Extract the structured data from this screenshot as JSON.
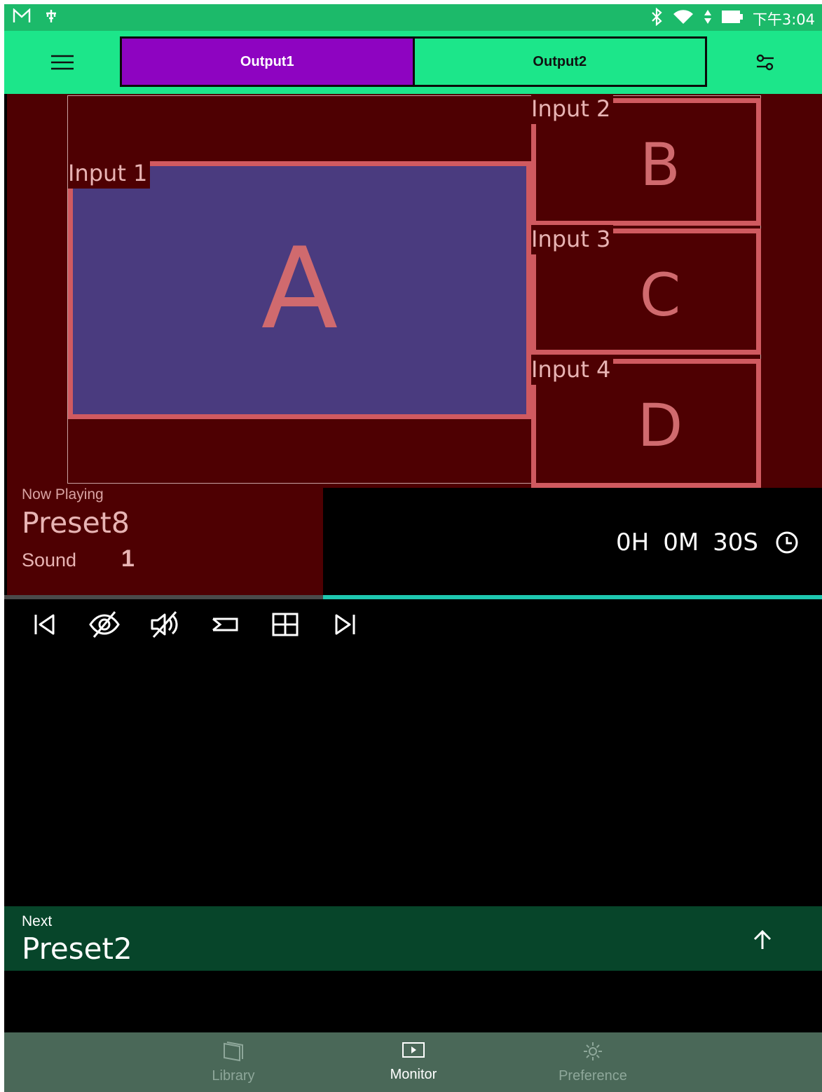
{
  "status_bar": {
    "time": "下午3:04",
    "icons": [
      "gmail-icon",
      "usb-debug-icon",
      "bluetooth-icon",
      "wifi-icon",
      "data-arrows-icon",
      "battery-icon"
    ]
  },
  "header": {
    "menu_icon": "hamburger-icon",
    "tabs": [
      {
        "label": "Output1",
        "active": true
      },
      {
        "label": "Output2",
        "active": false
      }
    ],
    "filter_icon": "tune-icon"
  },
  "monitor": {
    "windows": [
      {
        "label": "Input 1",
        "letter": "A"
      },
      {
        "label": "Input 2",
        "letter": "B"
      },
      {
        "label": "Input 3",
        "letter": "C"
      },
      {
        "label": "Input 4",
        "letter": "D"
      }
    ]
  },
  "now_playing": {
    "label": "Now Playing",
    "preset": "Preset8",
    "sound_label": "Sound",
    "sound_value": "1"
  },
  "timer": {
    "hours": "0H",
    "minutes": "0M",
    "seconds": "30S",
    "icon": "clock-icon"
  },
  "progress": {
    "fraction": 0.39
  },
  "controls": [
    {
      "name": "skip-previous-icon"
    },
    {
      "name": "eye-off-icon"
    },
    {
      "name": "volume-off-icon"
    },
    {
      "name": "input-icon"
    },
    {
      "name": "grid-icon"
    },
    {
      "name": "skip-next-icon"
    }
  ],
  "next": {
    "label": "Next",
    "preset": "Preset2",
    "icon": "arrow-up-icon"
  },
  "bottom_nav": [
    {
      "label": "Library",
      "icon": "library-icon",
      "active": false
    },
    {
      "label": "Monitor",
      "icon": "monitor-icon",
      "active": true
    },
    {
      "label": "Preference",
      "icon": "gear-icon",
      "active": false
    }
  ],
  "colors": {
    "header": "#1ce68a",
    "active_tab": "#8e04c1",
    "canvas_bg": "#4e0002",
    "window_border": "#d05a60",
    "main_window_fill": "#4a3b7f",
    "progress": "#1ec8b0",
    "next_bar": "#07452a",
    "bottom_nav": "#4a6858"
  }
}
